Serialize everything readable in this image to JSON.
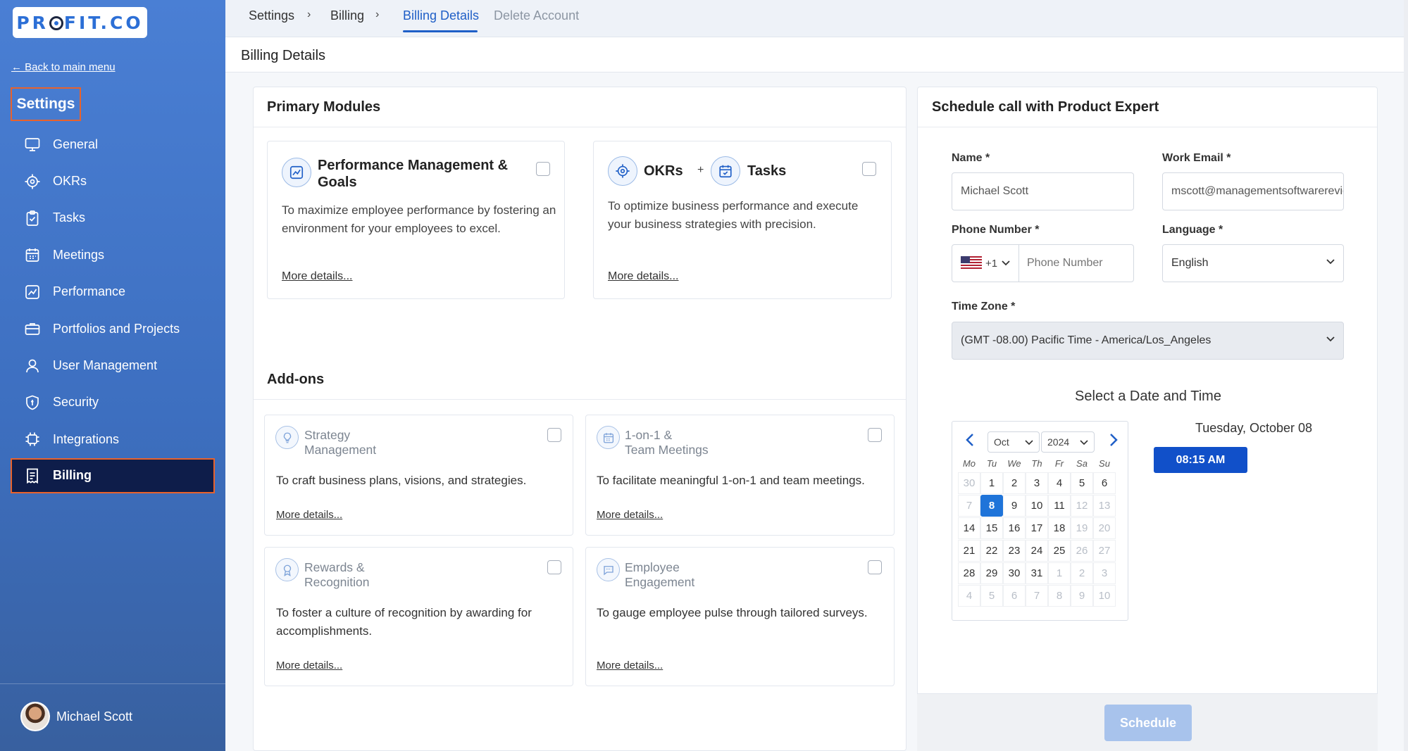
{
  "sidebar": {
    "logo": "PROFIT.CO",
    "back_link": "← Back to main menu",
    "section_title": "Settings",
    "items": [
      {
        "label": "General",
        "icon": "monitor-icon"
      },
      {
        "label": "OKRs",
        "icon": "target-icon"
      },
      {
        "label": "Tasks",
        "icon": "clipboard-check-icon"
      },
      {
        "label": "Meetings",
        "icon": "calendar-icon"
      },
      {
        "label": "Performance",
        "icon": "chart-line-icon"
      },
      {
        "label": "Portfolios and Projects",
        "icon": "briefcase-icon"
      },
      {
        "label": "User Management",
        "icon": "user-icon"
      },
      {
        "label": "Security",
        "icon": "shield-icon"
      },
      {
        "label": "Integrations",
        "icon": "chip-icon"
      },
      {
        "label": "Billing",
        "icon": "receipt-icon",
        "active": true
      }
    ],
    "user_name": "Michael Scott"
  },
  "topbar": {
    "breadcrumbs": [
      "Settings",
      "Billing"
    ],
    "separator": "›",
    "active_tab": "Billing Details",
    "inactive_tab": "Delete Account"
  },
  "page": {
    "title": "Billing Details"
  },
  "primary": {
    "title": "Primary Modules",
    "modules": [
      {
        "title": "Performance Management & Goals",
        "desc": "To maximize employee performance by fostering an environment for your employees to excel.",
        "more": "More details..."
      },
      {
        "title_a": "OKRs",
        "plus": "+",
        "title_b": "Tasks",
        "desc": "To optimize business performance and execute your business strategies with precision.",
        "more": "More details..."
      }
    ]
  },
  "addons": {
    "title": "Add-ons",
    "items": [
      {
        "line1": "Strategy",
        "line2": "Management",
        "desc": "To craft business plans, visions, and strategies.",
        "more": "More details...",
        "icon": "lightbulb-icon"
      },
      {
        "line1": "1-on-1 &",
        "line2": "Team Meetings",
        "desc": "To facilitate meaningful 1-on-1 and team meetings.",
        "more": "More details...",
        "icon": "calendar-icon"
      },
      {
        "line1": "Rewards &",
        "line2": "Recognition",
        "desc": "To foster a culture of recognition by awarding for accomplishments.",
        "more": "More details...",
        "icon": "award-icon"
      },
      {
        "line1": "Employee",
        "line2": "Engagement",
        "desc": "To gauge employee pulse through tailored surveys.",
        "more": "More details...",
        "icon": "chat-icon"
      }
    ]
  },
  "schedule": {
    "title": "Schedule call with Product Expert",
    "name_label": "Name *",
    "name_value": "Michael Scott",
    "email_label": "Work Email *",
    "email_value": "mscott@managementsoftwarereviews",
    "phone_label": "Phone Number *",
    "phone_code": "+1",
    "phone_placeholder": "Phone Number",
    "language_label": "Language *",
    "language_value": "English",
    "tz_label": "Time Zone *",
    "tz_value": "(GMT -08.00) Pacific Time - America/Los_Angeles",
    "datetime_title": "Select a Date and Time",
    "calendar": {
      "month": "Oct",
      "year": "2024",
      "weekdays": [
        "Mo",
        "Tu",
        "We",
        "Th",
        "Fr",
        "Sa",
        "Su"
      ],
      "weeks": [
        [
          "30",
          "1",
          "2",
          "3",
          "4",
          "5",
          "6"
        ],
        [
          "7",
          "8",
          "9",
          "10",
          "11",
          "12",
          "13"
        ],
        [
          "14",
          "15",
          "16",
          "17",
          "18",
          "19",
          "20"
        ],
        [
          "21",
          "22",
          "23",
          "24",
          "25",
          "26",
          "27"
        ],
        [
          "28",
          "29",
          "30",
          "31",
          "1",
          "2",
          "3"
        ],
        [
          "4",
          "5",
          "6",
          "7",
          "8",
          "9",
          "10"
        ]
      ],
      "selected_day": "8"
    },
    "selected_date": "Tuesday, October 08",
    "time_slot": "08:15 AM",
    "button": "Schedule"
  }
}
